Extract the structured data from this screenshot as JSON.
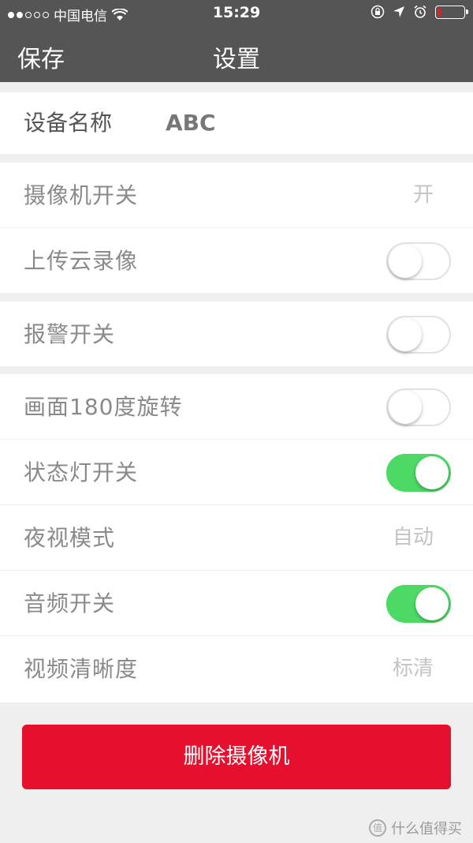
{
  "status_bar": {
    "carrier": "中国电信",
    "time": "15:29",
    "battery_color": "#e02020"
  },
  "nav": {
    "save_label": "保存",
    "title": "设置"
  },
  "device": {
    "label": "设备名称",
    "value": "ABC"
  },
  "settings": {
    "camera_switch": {
      "label": "摄像机开关",
      "value": "开"
    },
    "cloud_upload": {
      "label": "上传云录像",
      "toggle": "off"
    },
    "alarm_switch": {
      "label": "报警开关",
      "toggle": "off"
    },
    "rotate_180": {
      "label": "画面180度旋转",
      "toggle": "off"
    },
    "status_light": {
      "label": "状态灯开关",
      "toggle": "on"
    },
    "night_vision": {
      "label": "夜视模式",
      "value": "自动"
    },
    "audio_switch": {
      "label": "音频开关",
      "toggle": "on"
    },
    "video_quality": {
      "label": "视频清晰度",
      "value": "标清"
    }
  },
  "delete_button": {
    "label": "删除摄像机",
    "color": "#e60f2d"
  },
  "watermark": {
    "text": "什么值得买",
    "icon": "值"
  },
  "colors": {
    "toggle_on": "#4cd964",
    "nav_bg": "#555555"
  }
}
